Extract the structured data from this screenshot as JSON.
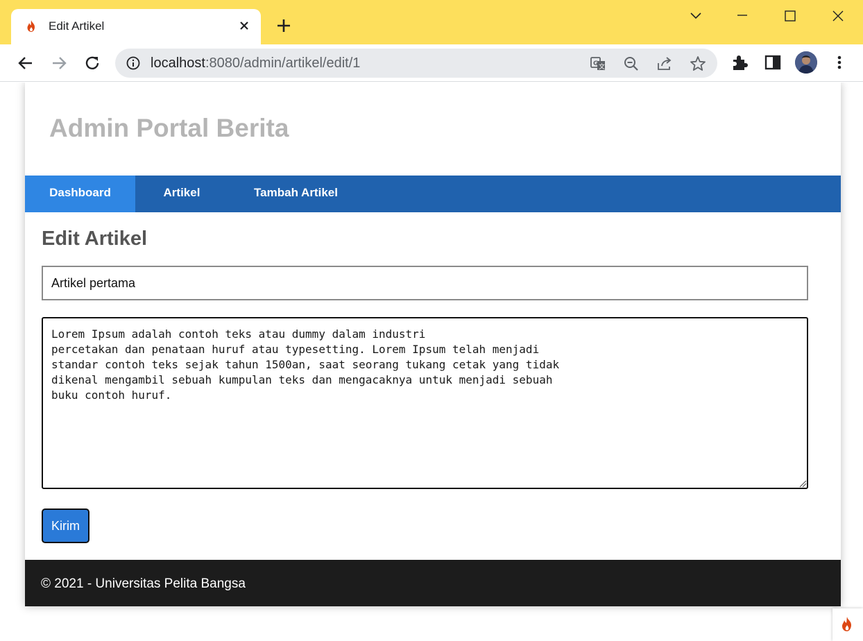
{
  "browser": {
    "tab_title": "Edit Artikel",
    "url_host": "localhost",
    "url_path": ":8080/admin/artikel/edit/1",
    "icons": [
      "favicon-flame-icon",
      "close-icon",
      "plus-icon",
      "chevron-down-icon",
      "minimize-icon",
      "maximize-icon",
      "window-close-icon",
      "back-icon",
      "forward-icon",
      "reload-icon",
      "info-icon",
      "translate-icon",
      "zoom-out-icon",
      "share-icon",
      "star-icon",
      "extensions-icon",
      "side-panel-icon",
      "avatar",
      "kebab-menu-icon"
    ]
  },
  "site": {
    "title": "Admin Portal Berita",
    "nav": [
      {
        "label": "Dashboard",
        "active": true
      },
      {
        "label": "Artikel",
        "active": false
      },
      {
        "label": "Tambah Artikel",
        "active": false
      }
    ]
  },
  "form": {
    "heading": "Edit Artikel",
    "title_value": "Artikel pertama",
    "body_value": "Lorem Ipsum adalah contoh teks atau dummy dalam industri\npercetakan dan penataan huruf atau typesetting. Lorem Ipsum telah menjadi\nstandar contoh teks sejak tahun 1500an, saat seorang tukang cetak yang tidak\ndikenal mengambil sebuah kumpulan teks dan mengacaknya untuk menjadi sebuah\nbuku contoh huruf.",
    "submit_label": "Kirim"
  },
  "footer": {
    "text": "© 2021 - Universitas Pelita Bangsa"
  },
  "colors": {
    "titlebar": "#fddf5c",
    "navbar": "#2062ae",
    "nav_active": "#2f86e3",
    "button": "#2a7ad8",
    "footer": "#1c1c1c",
    "site_title": "#b5b5b5"
  }
}
